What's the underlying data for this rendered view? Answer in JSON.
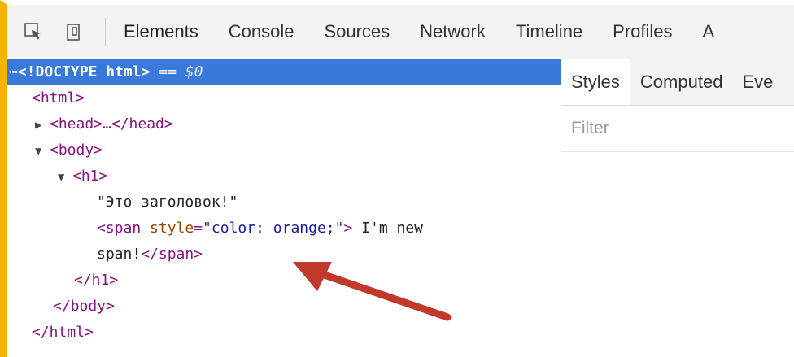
{
  "toolbar": {
    "tabs": [
      "Elements",
      "Console",
      "Sources",
      "Network",
      "Timeline",
      "Profiles",
      "A"
    ]
  },
  "elements": {
    "line0": {
      "prefix": "⋯",
      "doctype": "<!DOCTYPE html>",
      "eq": " == ",
      "ref": "$0"
    },
    "html_open": "<html>",
    "head": "<head>…</head>",
    "body_open": "<body>",
    "h1_open": "<h1>",
    "text_node": "\"Это заголовок!\"",
    "span_open_lt": "<span ",
    "span_attr_name": "style",
    "span_attr_eq": "=\"",
    "span_attr_val": "color: orange;",
    "span_attr_close": "\">",
    "span_text1": " I'm new",
    "span_text2": "span!",
    "span_close": "</span>",
    "h1_close": "</h1>",
    "body_close": "</body>",
    "html_close": "</html>"
  },
  "styles": {
    "tabs": [
      "Styles",
      "Computed",
      "Eve"
    ],
    "filter_placeholder": "Filter"
  },
  "colors": {
    "frame": "#f4b400",
    "selection": "#3879d9",
    "arrow": "#c0392b"
  }
}
